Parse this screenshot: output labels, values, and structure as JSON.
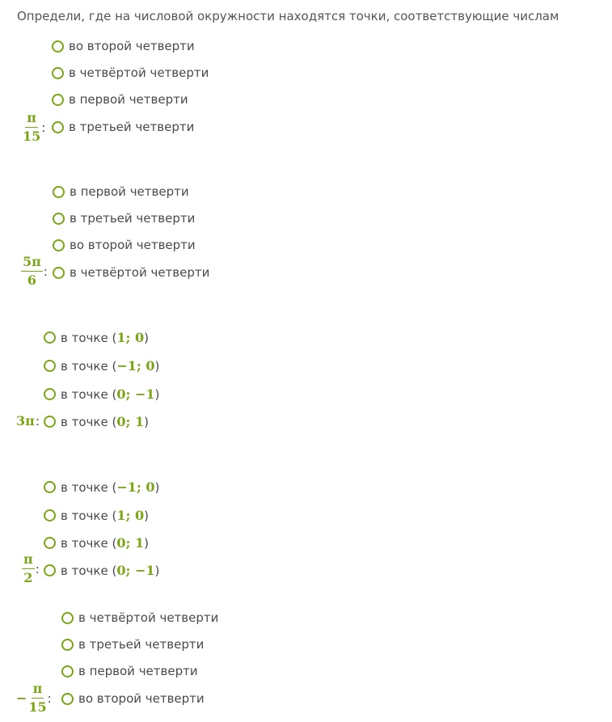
{
  "question": "Определи, где на числовой окружности находятся точки, соответствующие числам",
  "blocks": [
    {
      "label": {
        "sign": "",
        "num": "π",
        "den": "15",
        "colon": ":"
      },
      "options": [
        "во второй четверти",
        "в четвёртой четверти",
        "в первой четверти",
        "в третьей четверти"
      ]
    },
    {
      "label": {
        "sign": "",
        "num": "5π",
        "den": "6",
        "colon": ":"
      },
      "options": [
        "в первой четверти",
        "в третьей четверти",
        "во второй четверти",
        "в четвёртой четверти"
      ]
    },
    {
      "label": {
        "text": "3π",
        "colon": ":"
      },
      "prefix": "в точке",
      "options": [
        {
          "open": "(",
          "coord": "1; 0",
          "close": ")"
        },
        {
          "open": "(",
          "coord": "−1; 0",
          "close": ")"
        },
        {
          "open": "(",
          "coord": "0; −1",
          "close": ")"
        },
        {
          "open": "(",
          "coord": "0; 1",
          "close": ")"
        }
      ]
    },
    {
      "label": {
        "sign": "",
        "num": "π",
        "den": "2",
        "colon": ":"
      },
      "prefix": "в точке",
      "options": [
        {
          "open": "(",
          "coord": "−1; 0",
          "close": ")"
        },
        {
          "open": "(",
          "coord": "1; 0",
          "close": ")"
        },
        {
          "open": "(",
          "coord": "0; 1",
          "close": ")"
        },
        {
          "open": "(",
          "coord": "0; −1",
          "close": ")"
        }
      ]
    },
    {
      "label": {
        "sign": "−",
        "num": "π",
        "den": "15",
        "colon": ":"
      },
      "options": [
        "в четвёртой четверти",
        "в третьей четверти",
        "в первой четверти",
        "во второй четверти"
      ]
    }
  ],
  "colors": {
    "accent": "#7aa515",
    "text": "#4a4a4a"
  }
}
